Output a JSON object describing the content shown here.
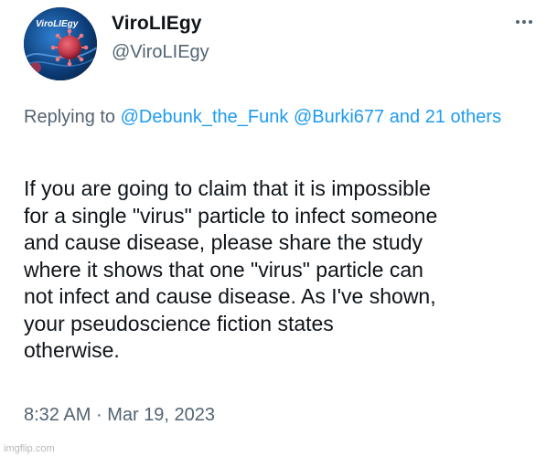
{
  "author": {
    "display_name": "ViroLIEgy",
    "handle": "@ViroLIEgy",
    "avatar_text": "ViroLIEgy"
  },
  "reply": {
    "prefix": "Replying to",
    "mention_1": "@Debunk_the_Funk",
    "mention_2": "@Burki677",
    "others_word_1": "and",
    "others_word_2": "21",
    "others_word_3": "others"
  },
  "tweet": {
    "lines": [
      "If you are going to claim that it is impossible",
      "for a single \"virus\" particle to infect someone",
      "and cause disease, please share the study",
      "where it shows that one \"virus\" particle can",
      "not infect and cause disease. As I've shown,",
      "your pseudoscience fiction states",
      "otherwise."
    ]
  },
  "meta": {
    "time": "8:32 AM",
    "separator": "·",
    "date": "Mar 19, 2023"
  },
  "watermark": "imgflip.com",
  "icons": {
    "more": "more-options-icon"
  },
  "colors": {
    "text_primary": "#0f1419",
    "text_secondary": "#536471",
    "link": "#1d9bf0",
    "virus": "#c0394a"
  }
}
